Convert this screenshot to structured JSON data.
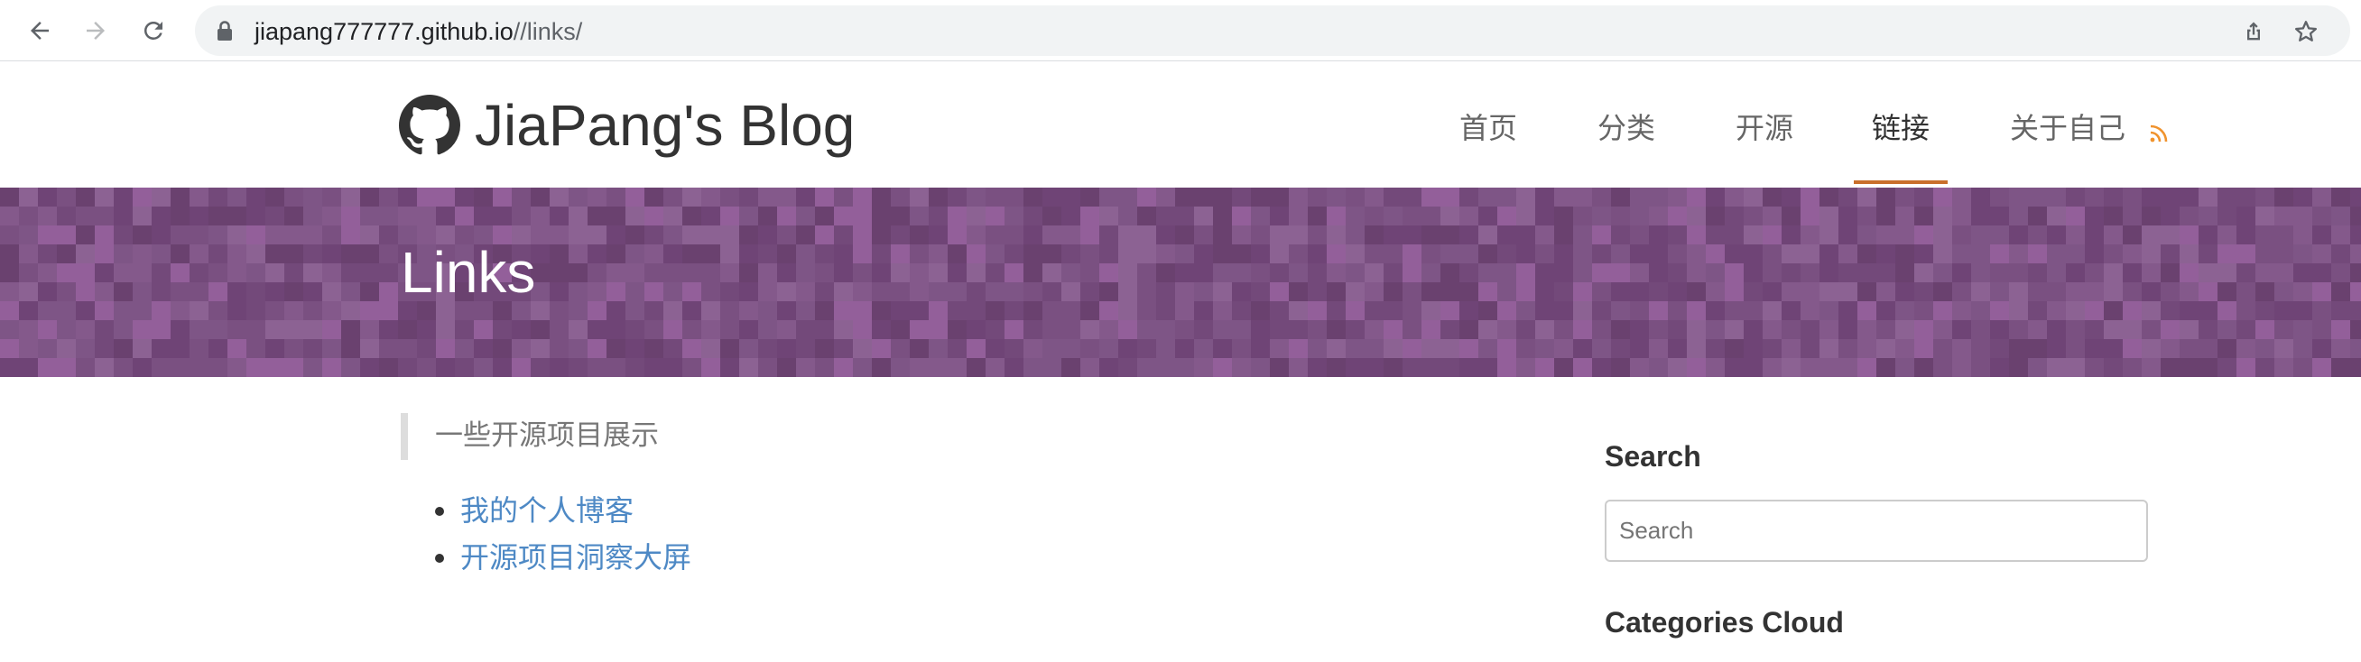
{
  "browser": {
    "url_host": "jiapang777777.github.io",
    "url_path": "//links/",
    "icons": {
      "back": "back-arrow-icon",
      "forward": "forward-arrow-icon",
      "reload": "reload-icon",
      "lock": "lock-icon",
      "share": "share-icon",
      "bookmark": "star-icon"
    }
  },
  "header": {
    "site_title": "JiaPang's Blog",
    "logo_icon": "github-octocat-icon",
    "nav": [
      {
        "label": "首页",
        "active": false
      },
      {
        "label": "分类",
        "active": false
      },
      {
        "label": "开源",
        "active": false
      },
      {
        "label": "链接",
        "active": true
      },
      {
        "label": "关于自己",
        "active": false
      }
    ],
    "rss_icon": "rss-icon",
    "accent_color": "#c96f2c"
  },
  "banner": {
    "title": "Links",
    "background_color": "#774d7e"
  },
  "main": {
    "intro": "一些开源项目展示",
    "links": [
      {
        "label": "我的个人博客"
      },
      {
        "label": "开源项目洞察大屏"
      }
    ],
    "link_color": "#4e89c5"
  },
  "sidebar": {
    "search_heading": "Search",
    "search_placeholder": "Search",
    "categories_heading": "Categories Cloud"
  }
}
